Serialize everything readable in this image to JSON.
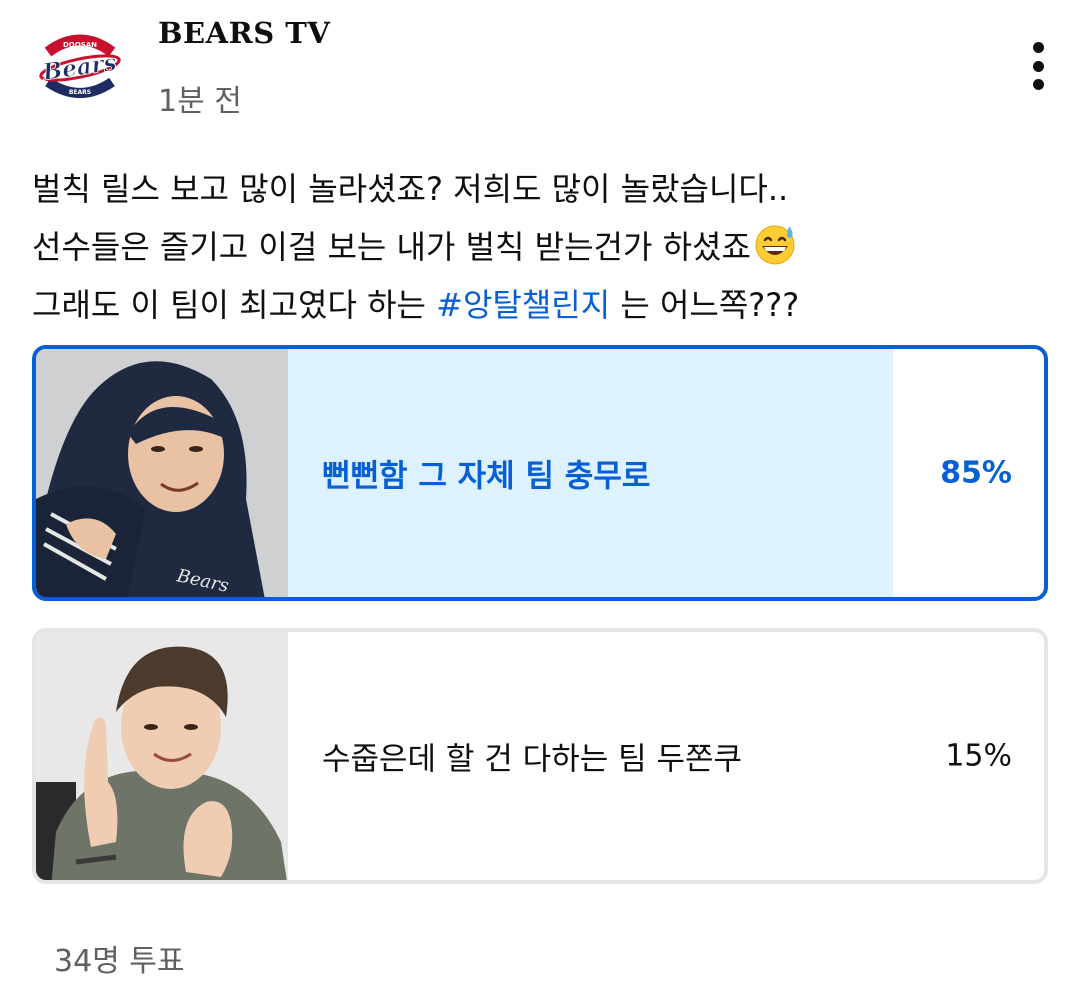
{
  "channel": {
    "name": "BEARS TV",
    "timestamp": "1분 전",
    "logo_text": "Bears",
    "logo_top_text": "DOOSAN",
    "logo_bottom_text": "BEARS"
  },
  "post": {
    "line1": "벌칙 릴스 보고 많이 놀라셨죠? 저희도 많이 놀랐습니다..",
    "line2": "선수들은 즐기고 이걸 보는 내가 벌칙 받는건가 하셨죠",
    "line2_emoji": "grinning-sweat-emoji",
    "line3_before": "그래도 이 팀이 최고였다 하는 ",
    "line3_hashtag": "#앙탈챌린지",
    "line3_after": " 는 어느쪽???"
  },
  "poll": {
    "options": [
      {
        "label": "뻔뻔함 그 자체 팀 충무로",
        "percent_label": "85%",
        "percent": 85,
        "selected": true,
        "thumb_logo": "Bears"
      },
      {
        "label": "수줍은데 할 건 다하는 팀 두쫀쿠",
        "percent_label": "15%",
        "percent": 15,
        "selected": false
      }
    ],
    "vote_count": "34명 투표"
  },
  "icons": {
    "menu": "more-vertical-icon"
  },
  "colors": {
    "accent": "#065fd4",
    "selected_fill": "#def1ff",
    "unselected_fill": "#e5e5e5",
    "secondary_text": "#606060",
    "logo_navy": "#1d2c63",
    "logo_red": "#c8102e"
  }
}
